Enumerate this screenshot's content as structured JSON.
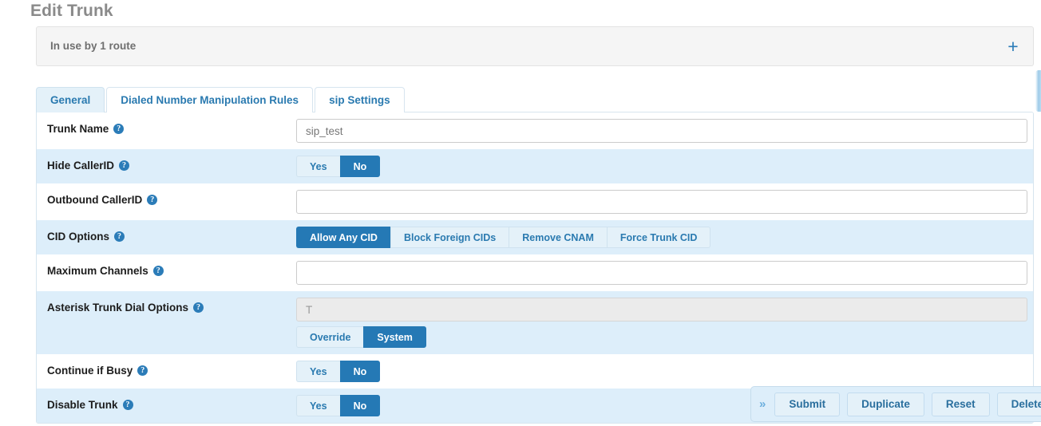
{
  "page": {
    "title": "Edit Trunk"
  },
  "notice": {
    "text": "In use by 1 route",
    "expand_icon": "plus-icon",
    "expand_glyph": "+"
  },
  "tabs": [
    {
      "label": "General",
      "active": true
    },
    {
      "label": "Dialed Number Manipulation Rules",
      "active": false
    },
    {
      "label": "sip Settings",
      "active": false
    }
  ],
  "form": {
    "help_glyph": "?",
    "rows": [
      {
        "name": "trunk-name",
        "label": "Trunk Name",
        "type": "text",
        "value": "sip_test",
        "placeholder": "",
        "alt": false
      },
      {
        "name": "hide-callerid",
        "label": "Hide CallerID",
        "type": "buttons",
        "options": [
          "Yes",
          "No"
        ],
        "selected": "No",
        "alt": true
      },
      {
        "name": "outbound-callerid",
        "label": "Outbound CallerID",
        "type": "text",
        "value": "",
        "placeholder": "",
        "alt": false
      },
      {
        "name": "cid-options",
        "label": "CID Options",
        "type": "buttons",
        "options": [
          "Allow Any CID",
          "Block Foreign CIDs",
          "Remove CNAM",
          "Force Trunk CID"
        ],
        "selected": "Allow Any CID",
        "alt": true
      },
      {
        "name": "maximum-channels",
        "label": "Maximum Channels",
        "type": "text",
        "value": "",
        "placeholder": "",
        "alt": false
      },
      {
        "name": "asterisk-trunk-dial-options",
        "label": "Asterisk Trunk Dial Options",
        "type": "text-and-buttons",
        "value": "",
        "placeholder": "T",
        "disabled": true,
        "options": [
          "Override",
          "System"
        ],
        "selected": "System",
        "alt": true
      },
      {
        "name": "continue-if-busy",
        "label": "Continue if Busy",
        "type": "buttons",
        "options": [
          "Yes",
          "No"
        ],
        "selected": "No",
        "alt": false
      },
      {
        "name": "disable-trunk",
        "label": "Disable Trunk",
        "type": "buttons",
        "options": [
          "Yes",
          "No"
        ],
        "selected": "No",
        "alt": true
      }
    ]
  },
  "action_bar": {
    "collapse_glyph": "»",
    "buttons": [
      "Submit",
      "Duplicate",
      "Reset",
      "Delete"
    ]
  },
  "colors": {
    "accent": "#2579b5",
    "link": "#2a7ab0",
    "row_alt": "#ddeefa",
    "btn_light": "#e4f1f9",
    "title_gray": "#8a8a8a"
  }
}
